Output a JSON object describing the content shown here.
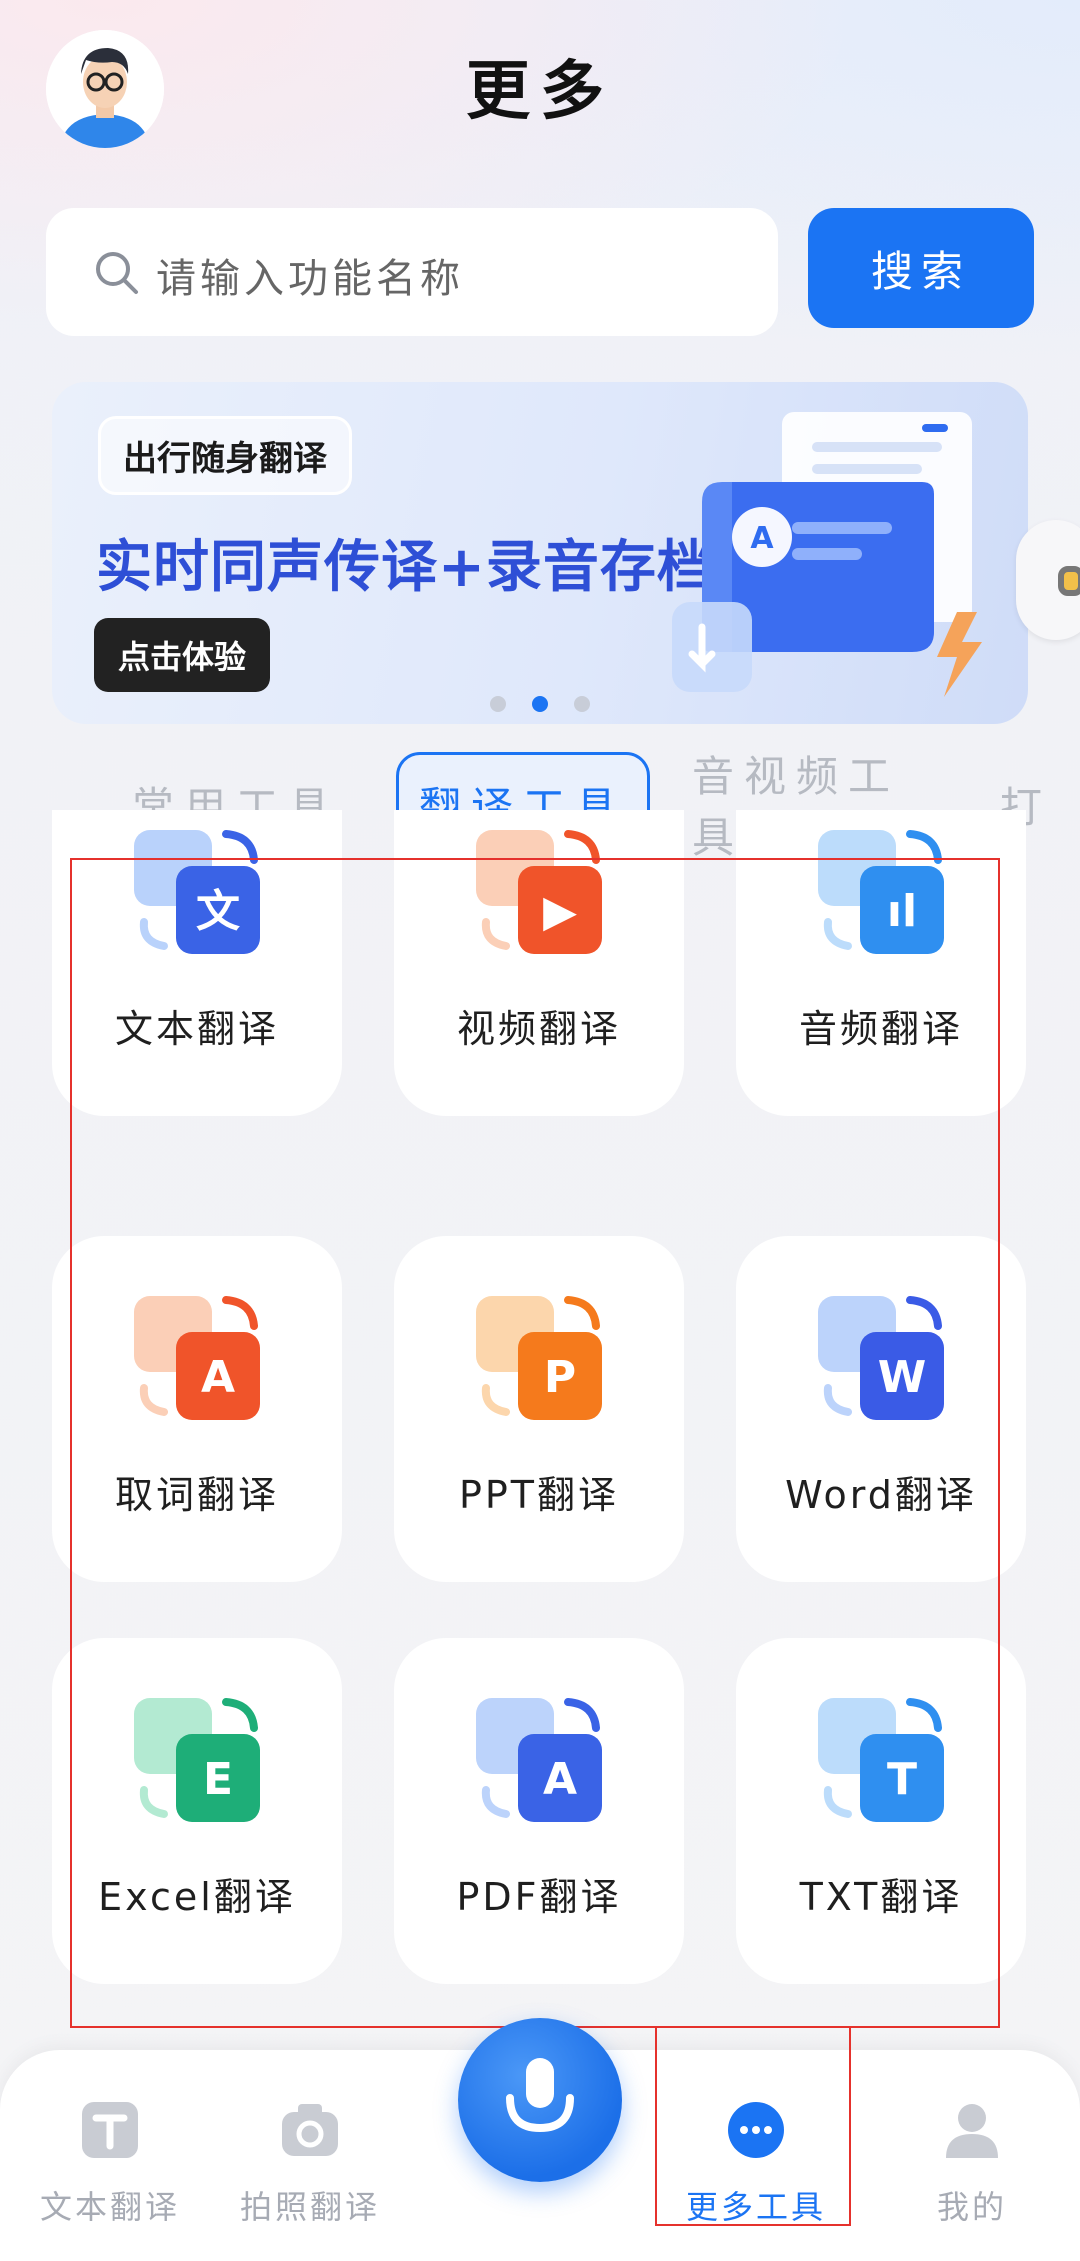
{
  "header": {
    "title": "更多"
  },
  "search": {
    "placeholder": "请输入功能名称",
    "button_label": "搜索"
  },
  "banner": {
    "tag": "出行随身翻译",
    "headline": "实时同声传译+录音存档",
    "cta": "点击体验",
    "dots": 3,
    "active_dot": 1
  },
  "tabs": [
    {
      "label": "常用工具",
      "active": false
    },
    {
      "label": "翻译工具",
      "active": true
    },
    {
      "label": "音视频工具",
      "active": false
    },
    {
      "label": "打",
      "active": false
    }
  ],
  "tools": [
    {
      "label": "文本翻译",
      "icon": "text-translate-icon",
      "glyph": "文",
      "accent": "#3a63e6",
      "back": "#b9d2fb"
    },
    {
      "label": "视频翻译",
      "icon": "video-translate-icon",
      "glyph": "▶",
      "accent": "#f0542a",
      "back": "#fbcfb7"
    },
    {
      "label": "音频翻译",
      "icon": "audio-translate-icon",
      "glyph": "ıl",
      "accent": "#2f8ff0",
      "back": "#bcdcfb"
    },
    {
      "label": "取词翻译",
      "icon": "word-pick-translate-icon",
      "glyph": "A",
      "accent": "#f0542a",
      "back": "#fbcfb7"
    },
    {
      "label": "PPT翻译",
      "icon": "ppt-translate-icon",
      "glyph": "P",
      "accent": "#f57a1c",
      "back": "#fcd6ac"
    },
    {
      "label": "Word翻译",
      "icon": "word-translate-icon",
      "glyph": "W",
      "accent": "#3a5be6",
      "back": "#bcd3fb"
    },
    {
      "label": "Excel翻译",
      "icon": "excel-translate-icon",
      "glyph": "E",
      "accent": "#1eae78",
      "back": "#b3ead2"
    },
    {
      "label": "PDF翻译",
      "icon": "pdf-translate-icon",
      "glyph": "A",
      "accent": "#3a63e6",
      "back": "#bcd3fb"
    },
    {
      "label": "TXT翻译",
      "icon": "txt-translate-icon",
      "glyph": "T",
      "accent": "#2f8ff0",
      "back": "#bcdcfb"
    }
  ],
  "bottom_nav": [
    {
      "label": "文本翻译",
      "icon": "text-T-icon",
      "active": false
    },
    {
      "label": "拍照翻译",
      "icon": "camera-icon",
      "active": false
    },
    {
      "label": "更多工具",
      "icon": "more-dots-icon",
      "active": true
    },
    {
      "label": "我的",
      "icon": "user-icon",
      "active": false
    }
  ],
  "colors": {
    "brand": "#1b74f3",
    "highlight_frame": "#e5312c"
  }
}
